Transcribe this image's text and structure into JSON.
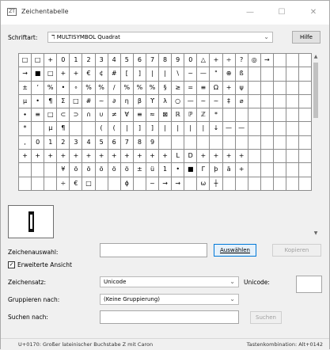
{
  "window": {
    "title": "Zeichentabelle",
    "icon_text": "ZT",
    "minimize": "—",
    "maximize": "☐",
    "close": "✕"
  },
  "font_row": {
    "label": "Schriftart:",
    "value": "ℸ MULTISYMBOL Quadrat",
    "help_button": "Hilfe"
  },
  "grid_rows": [
    [
      "□",
      "□",
      "+",
      "0",
      "1",
      "2",
      "3",
      "4",
      "5",
      "6",
      "7",
      "8",
      "9",
      "0",
      "△",
      "+",
      "÷",
      "?",
      "◎",
      "→"
    ],
    [
      "→",
      "■",
      "□",
      "+",
      "+",
      "€",
      "¢",
      "#",
      "[",
      "]",
      "|",
      "|",
      "\\",
      "~",
      "—",
      "\"",
      "⊕",
      "ß"
    ],
    [
      "±",
      "ʼ",
      "%",
      "•",
      "∘",
      "%",
      "%",
      "/",
      "%",
      "%",
      "%",
      "§",
      "≥",
      "=",
      "≡",
      "Ω",
      "+",
      "ψ"
    ],
    [
      "μ",
      "•",
      "¶",
      "Σ",
      "□",
      "#",
      "~",
      "∂",
      "η",
      "β",
      "ϒ",
      "λ",
      "○",
      "—",
      "~",
      "~",
      "‡",
      "⌀"
    ],
    [
      "∙",
      "≡",
      "□",
      "⊂",
      "⊃",
      "∩",
      "∪",
      "≠",
      "Ɐ",
      "≡",
      "≈",
      "⊠",
      "ℝ",
      "ℙ",
      "ℤ",
      "*",
      "",
      ""
    ],
    [
      "*",
      "",
      "μ",
      "¶",
      "",
      "",
      "(",
      "(",
      "|",
      "]",
      "]",
      "|",
      "|",
      "|",
      "|",
      "↓",
      "—",
      "—"
    ],
    [
      ",",
      "0",
      "1",
      "2",
      "3",
      "4",
      "5",
      "6",
      "7",
      "8",
      "9",
      "",
      "",
      "",
      "",
      "",
      "",
      ""
    ],
    [
      "+",
      "+",
      "+",
      "+",
      "+",
      "+",
      "+",
      "+",
      "+",
      "+",
      "+",
      "+",
      "L",
      "D",
      "+",
      "+",
      "+",
      "+"
    ],
    [
      "",
      "",
      "",
      "¥",
      "ö",
      "ö",
      "ö",
      "ö",
      "ö",
      "±",
      "ü",
      "1",
      "•",
      "■",
      "Γ",
      "þ",
      "ä",
      "+"
    ],
    [
      "",
      "",
      "",
      "÷",
      "€",
      "□",
      "",
      "",
      "ɸ",
      "",
      "~",
      "→",
      "→",
      "",
      "ω",
      "┼",
      "",
      ""
    ]
  ],
  "zoom_char_name": "selected-character",
  "copy_row": {
    "label": "Zeichenauswahl:",
    "value": "",
    "select_button": "Auswählen",
    "copy_button": "Kopieren"
  },
  "advanced": {
    "checked": true,
    "label": "Erweiterte Ansicht"
  },
  "charset_row": {
    "label": "Zeichensatz:",
    "value": "Unicode",
    "unicode_label": "Unicode:",
    "unicode_value": ""
  },
  "group_row": {
    "label": "Gruppieren nach:",
    "value": "(Keine Gruppierung)"
  },
  "search_row": {
    "label": "Suchen nach:",
    "value": "",
    "search_button": "Suchen"
  },
  "status": {
    "left": "U+0170: Großer lateinischer Buchstabe Z mit Caron",
    "right": "Tastenkombination: Alt+0142"
  },
  "scrollbar": {
    "up_icon": "▲",
    "down_icon": "▼"
  }
}
